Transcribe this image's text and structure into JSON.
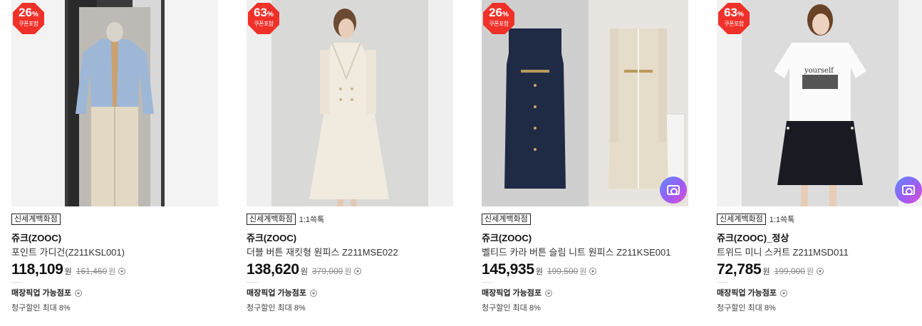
{
  "products": [
    {
      "discount_pct": "26",
      "discount_unit": "%",
      "coupon_label": "쿠폰포함",
      "store_tag": "신세계백화점",
      "chat_tag": "",
      "brand": "쥬크(ZOOC)",
      "name": "포인트 가디건(Z211KSL001)",
      "price": "118,109",
      "price_unit": "원",
      "original_price": "161,460",
      "original_unit": "원",
      "pickup_label": "매장픽업 가능점포",
      "card_discount": "청구할인 최대 8%",
      "has_camera": false
    },
    {
      "discount_pct": "63",
      "discount_unit": "%",
      "coupon_label": "쿠폰포함",
      "store_tag": "신세계백화점",
      "chat_tag": "1:1쓱톡",
      "brand": "쥬크(ZOOC)",
      "name": "더블 버튼 재킷형 원피스 Z211MSE022",
      "price": "138,620",
      "price_unit": "원",
      "original_price": "379,000",
      "original_unit": "원",
      "pickup_label": "매장픽업 가능점포",
      "card_discount": "청구할인 최대 8%",
      "has_camera": false
    },
    {
      "discount_pct": "26",
      "discount_unit": "%",
      "coupon_label": "쿠폰포함",
      "store_tag": "신세계백화점",
      "chat_tag": "",
      "brand": "쥬크(ZOOC)",
      "name": "벨티드 카라 버튼 슬림 니트 원피스 Z211KSE001",
      "price": "145,935",
      "price_unit": "원",
      "original_price": "199,500",
      "original_unit": "원",
      "pickup_label": "매장픽업 가능점포",
      "card_discount": "청구할인 최대 8%",
      "has_camera": true
    },
    {
      "discount_pct": "63",
      "discount_unit": "%",
      "coupon_label": "쿠폰포함",
      "store_tag": "신세계백화점",
      "chat_tag": "1:1쓱톡",
      "brand": "쥬크(ZOOC)_정상",
      "name": "트위드 미니 스커트 Z211MSD011",
      "price": "72,785",
      "price_unit": "원",
      "original_price": "199,000",
      "original_unit": "원",
      "pickup_label": "매장픽업 가능점포",
      "card_discount": "청구할인 최대 8%",
      "has_camera": true
    }
  ],
  "colors": {
    "badge": "#f0312a",
    "camera_gradient": [
      "#5d8bff",
      "#9b5cf6",
      "#e04fd0"
    ]
  }
}
